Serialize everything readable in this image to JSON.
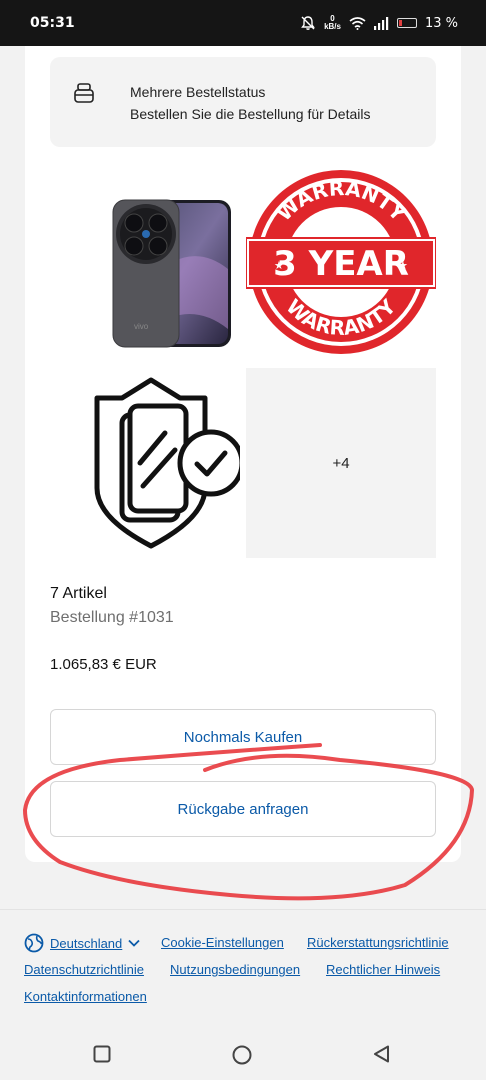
{
  "status_bar": {
    "time": "05:31",
    "net_speed_value": "0",
    "net_speed_unit": "kB/s",
    "battery": "13 %"
  },
  "order_status": {
    "title": "Mehrere Bestellstatus",
    "subtitle": "Bestellen Sie die Bestellung für Details"
  },
  "products": {
    "phone_brand": "vivo",
    "warranty_top": "WARRANTY",
    "warranty_middle": "3 YEAR",
    "warranty_bottom": "WARRANTY",
    "more_count": "+4"
  },
  "order": {
    "item_count": "7 Artikel",
    "number": "Bestellung #1031",
    "total": "1.065,83 € EUR"
  },
  "actions": {
    "buy_again": "Nochmals Kaufen",
    "request_return": "Rückgabe anfragen"
  },
  "footer": {
    "country": "Deutschland",
    "links": [
      "Cookie-Einstellungen",
      "Rückerstattungsrichtlinie",
      "Datenschutzrichtlinie",
      "Nutzungsbedingungen",
      "Rechtlicher Hinweis",
      "Kontaktinformationen"
    ]
  },
  "colors": {
    "link": "#0b5aa8",
    "warranty_red": "#e0262b",
    "annotation_red": "#e8383d",
    "status_bar": "#151515"
  },
  "icons": [
    "bell-off-icon",
    "wifi-icon",
    "signal-icon",
    "battery-icon",
    "order-box-icon",
    "globe-icon",
    "chevron-down-icon",
    "recent-apps-icon",
    "home-icon",
    "back-icon"
  ]
}
